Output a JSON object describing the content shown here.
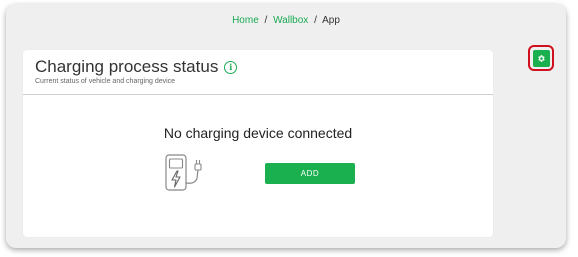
{
  "breadcrumb": {
    "items": [
      "Home",
      "Wallbox",
      "App"
    ],
    "separator": "/"
  },
  "status_card": {
    "title": "Charging process status",
    "info_icon": "info-icon",
    "subtitle": "Current status of vehicle and charging device",
    "empty_message": "No charging device connected",
    "add_label": "ADD",
    "illustration_icon": "charging-station-icon"
  },
  "settings": {
    "icon": "gear-icon"
  },
  "colors": {
    "accent": "#1ab050",
    "highlight": "#d0101e"
  }
}
